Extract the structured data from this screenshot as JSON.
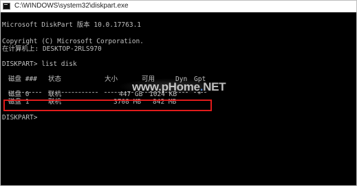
{
  "window": {
    "title": "C:\\WINDOWS\\system32\\diskpart.exe",
    "icon": "console-window-icon"
  },
  "console": {
    "version_line": "Microsoft DiskPart 版本 10.0.17763.1",
    "copyright_line": "Copyright (C) Microsoft Corporation.",
    "computer_line": "在计算机上: DESKTOP-2RLS970",
    "command_line": "DISKPART> list disk",
    "prompt": "DISKPART>"
  },
  "disk_table": {
    "headers": [
      "磁盘 ###",
      "状态",
      "大小",
      "可用",
      "Dyn",
      "Gpt"
    ],
    "rows": [
      {
        "disk": "磁盘 0",
        "status": "联机",
        "size": "447 GB",
        "free": "1024 KB",
        "dyn": "",
        "gpt": "*"
      },
      {
        "disk": "磁盘 1",
        "status": "联机",
        "size": "3708 MB",
        "free": "842 MB",
        "dyn": "",
        "gpt": ""
      }
    ],
    "highlight_color": "#e11b1b"
  },
  "watermark": {
    "text_prefix": "www.",
    "text_main": "pHome",
    "text_dot": ".",
    "text_suffix": "NET"
  }
}
